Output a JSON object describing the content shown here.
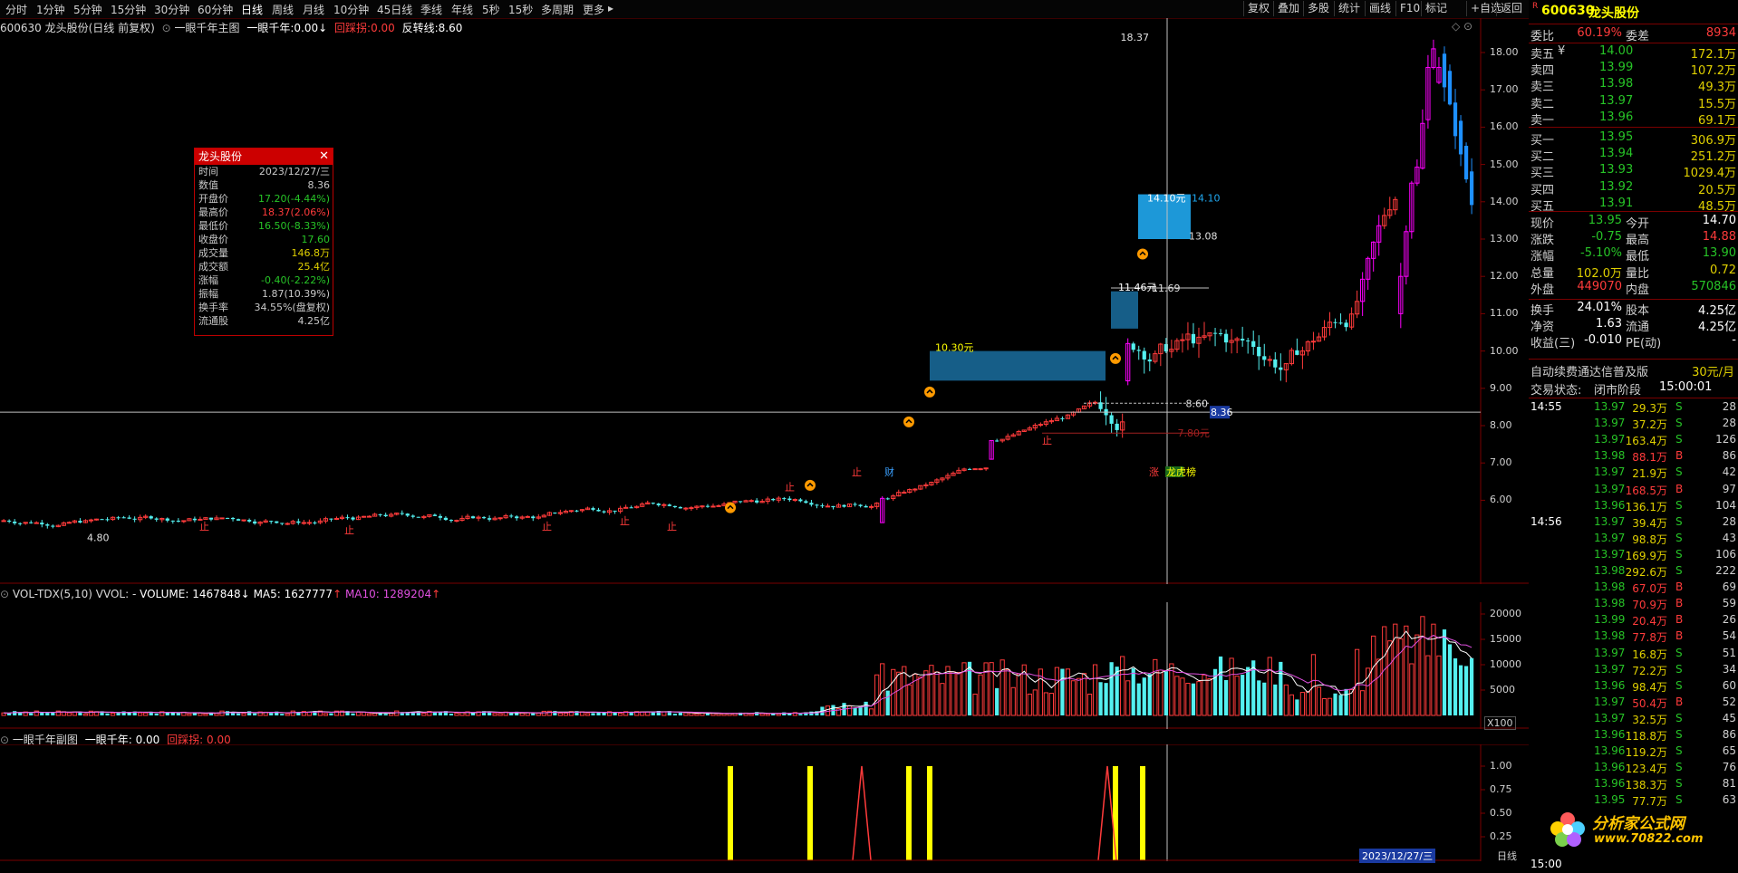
{
  "toolbar": {
    "periods": [
      "分时",
      "1分钟",
      "5分钟",
      "15分钟",
      "30分钟",
      "60分钟",
      "日线",
      "周线",
      "月线",
      "10分钟",
      "45日线",
      "季线",
      "年线",
      "5秒",
      "15秒",
      "多周期",
      "更多"
    ],
    "active_period": "日线",
    "right_buttons": [
      "复权",
      "叠加",
      "多股",
      "统计",
      "画线",
      "F10",
      "标记",
      "+自选",
      "返回"
    ]
  },
  "main_info": {
    "code_name": "600630 龙头股份(日线 前复权)",
    "indicator_name": "一眼千年主图",
    "ind1_label": "一眼千年:",
    "ind1_value": "0.00",
    "ind2_label": "回踩拐:",
    "ind2_value": "0.00",
    "ind3_label": "反转线:",
    "ind3_value": "8.60"
  },
  "price_axis": [
    "18.00",
    "17.00",
    "16.00",
    "15.00",
    "14.00",
    "13.00",
    "12.00",
    "11.00",
    "10.00",
    "9.00",
    "8.00",
    "7.00",
    "6.00"
  ],
  "chart_labels": {
    "high_label": "18.37",
    "low_label": "4.80",
    "cursor_price": "8.36",
    "reversal_label": "8.60",
    "support_label": "7.80元",
    "box1_label": "10.30元",
    "box2_label": "11.46元",
    "box2_right": "11.69",
    "box3_label": "14.10元",
    "box3_right": "14.10",
    "box3_low": "13.08",
    "up_marker": "止",
    "event_cai": "财",
    "event_zhang": "涨",
    "event_longhu": "龙虎榜"
  },
  "popup": {
    "title": "龙头股份",
    "rows": [
      {
        "k": "时间",
        "v": "2023/12/27/三",
        "c": "#c8c8c8"
      },
      {
        "k": "数值",
        "v": "8.36",
        "c": "#c8c8c8"
      },
      {
        "k": "开盘价",
        "v": "17.20(-4.44%)",
        "c": "#27c427"
      },
      {
        "k": "最高价",
        "v": "18.37(2.06%)",
        "c": "#ff3b3b"
      },
      {
        "k": "最低价",
        "v": "16.50(-8.33%)",
        "c": "#27c427"
      },
      {
        "k": "收盘价",
        "v": "17.60",
        "c": "#27c427"
      },
      {
        "k": "成交量",
        "v": "146.8万",
        "c": "#e0d000"
      },
      {
        "k": "成交额",
        "v": "25.4亿",
        "c": "#e0d000"
      },
      {
        "k": "涨幅",
        "v": "-0.40(-2.22%)",
        "c": "#27c427"
      },
      {
        "k": "振幅",
        "v": "1.87(10.39%)",
        "c": "#c8c8c8"
      },
      {
        "k": "换手率",
        "v": "34.55%(盘复权)",
        "c": "#c8c8c8"
      },
      {
        "k": "流通股",
        "v": "4.25亿",
        "c": "#c8c8c8"
      }
    ]
  },
  "vol_info": {
    "name": "VOL-TDX(5,10)",
    "vvol": "VVOL: -",
    "volume": "VOLUME: 1467848",
    "ma5": "MA5: 1627777",
    "ma10": "MA10: 1289204"
  },
  "vol_axis": [
    "20000",
    "15000",
    "10000",
    "5000"
  ],
  "vol_unit": "X100",
  "sub_info": {
    "name": "一眼千年副图",
    "ind1": "一眼千年: 0.00",
    "ind2": "回踩拐: 0.00"
  },
  "sub_axis": [
    "1.00",
    "0.75",
    "0.50",
    "0.25"
  ],
  "bottom": {
    "date_label": "2023/12/27/三",
    "period_label": "日线"
  },
  "quote": {
    "badge": "R",
    "code": "600630",
    "name": "龙头股份",
    "weibi_label": "委比",
    "weibi_value": "60.19%",
    "weicha_label": "委差",
    "weicha_value": "8934",
    "sells": [
      {
        "label": "卖五",
        "price": "14.00",
        "vol": "172.1万",
        "flag": "¥"
      },
      {
        "label": "卖四",
        "price": "13.99",
        "vol": "107.2万",
        "flag": ""
      },
      {
        "label": "卖三",
        "price": "13.98",
        "vol": "49.3万",
        "flag": ""
      },
      {
        "label": "卖二",
        "price": "13.97",
        "vol": "15.5万",
        "flag": ""
      },
      {
        "label": "卖一",
        "price": "13.96",
        "vol": "69.1万",
        "flag": ""
      }
    ],
    "buys": [
      {
        "label": "买一",
        "price": "13.95",
        "vol": "306.9万"
      },
      {
        "label": "买二",
        "price": "13.94",
        "vol": "251.2万"
      },
      {
        "label": "买三",
        "price": "13.93",
        "vol": "1029.4万"
      },
      {
        "label": "买四",
        "price": "13.92",
        "vol": "20.5万"
      },
      {
        "label": "买五",
        "price": "13.91",
        "vol": "48.5万"
      }
    ],
    "stats": [
      {
        "l1": "现价",
        "v1": "13.95",
        "c1": "#27c427",
        "l2": "今开",
        "v2": "14.70",
        "c2": "#ffffff"
      },
      {
        "l1": "涨跌",
        "v1": "-0.75",
        "c1": "#27c427",
        "l2": "最高",
        "v2": "14.88",
        "c2": "#ff3b3b"
      },
      {
        "l1": "涨幅",
        "v1": "-5.10%",
        "c1": "#27c427",
        "l2": "最低",
        "v2": "13.90",
        "c2": "#27c427"
      },
      {
        "l1": "总量",
        "v1": "102.0万",
        "c1": "#e0d000",
        "l2": "量比",
        "v2": "0.72",
        "c2": "#e0d000"
      },
      {
        "l1": "外盘",
        "v1": "449070",
        "c1": "#ff3b3b",
        "l2": "内盘",
        "v2": "570846",
        "c2": "#27c427"
      }
    ],
    "stats2": [
      {
        "l1": "换手",
        "v1": "24.01%",
        "l2": "股本",
        "v2": "4.25亿"
      },
      {
        "l1": "净资",
        "v1": "1.63",
        "l2": "流通",
        "v2": "4.25亿"
      },
      {
        "l1": "收益(三)",
        "v1": "-0.010",
        "l2": "PE(动)",
        "v2": "-"
      }
    ],
    "ad_text": "自动续费通达信普及版",
    "ad_price": "30元/月",
    "status_label": "交易状态:",
    "status_value": "闭市阶段",
    "status_time": "15:00:01"
  },
  "ticks": [
    {
      "t": "14:55",
      "p": "13.97",
      "v": "29.3万",
      "s": "S",
      "n": "28"
    },
    {
      "t": "",
      "p": "13.97",
      "v": "37.2万",
      "s": "S",
      "n": "28"
    },
    {
      "t": "",
      "p": "13.97",
      "v": "163.4万",
      "s": "S",
      "n": "126"
    },
    {
      "t": "",
      "p": "13.98",
      "v": "88.1万",
      "s": "B",
      "n": "86"
    },
    {
      "t": "",
      "p": "13.97",
      "v": "21.9万",
      "s": "S",
      "n": "42"
    },
    {
      "t": "",
      "p": "13.97",
      "v": "168.5万",
      "s": "B",
      "n": "97"
    },
    {
      "t": "",
      "p": "13.96",
      "v": "136.1万",
      "s": "S",
      "n": "104"
    },
    {
      "t": "14:56",
      "p": "13.97",
      "v": "39.4万",
      "s": "S",
      "n": "28"
    },
    {
      "t": "",
      "p": "13.97",
      "v": "98.8万",
      "s": "S",
      "n": "43"
    },
    {
      "t": "",
      "p": "13.97",
      "v": "169.9万",
      "s": "S",
      "n": "106"
    },
    {
      "t": "",
      "p": "13.98",
      "v": "292.6万",
      "s": "S",
      "n": "222"
    },
    {
      "t": "",
      "p": "13.98",
      "v": "67.0万",
      "s": "B",
      "n": "69"
    },
    {
      "t": "",
      "p": "13.98",
      "v": "70.9万",
      "s": "B",
      "n": "59"
    },
    {
      "t": "",
      "p": "13.99",
      "v": "20.4万",
      "s": "B",
      "n": "26"
    },
    {
      "t": "",
      "p": "13.98",
      "v": "77.8万",
      "s": "B",
      "n": "54"
    },
    {
      "t": "",
      "p": "13.97",
      "v": "16.8万",
      "s": "S",
      "n": "51"
    },
    {
      "t": "",
      "p": "13.97",
      "v": "72.2万",
      "s": "S",
      "n": "34"
    },
    {
      "t": "",
      "p": "13.96",
      "v": "98.4万",
      "s": "S",
      "n": "60"
    },
    {
      "t": "",
      "p": "13.97",
      "v": "50.4万",
      "s": "B",
      "n": "52"
    },
    {
      "t": "",
      "p": "13.97",
      "v": "32.5万",
      "s": "S",
      "n": "45"
    },
    {
      "t": "",
      "p": "13.96",
      "v": "118.8万",
      "s": "S",
      "n": "86"
    },
    {
      "t": "",
      "p": "13.96",
      "v": "119.2万",
      "s": "S",
      "n": "65"
    },
    {
      "t": "",
      "p": "13.96",
      "v": "123.4万",
      "s": "S",
      "n": "76"
    },
    {
      "t": "",
      "p": "13.96",
      "v": "138.3万",
      "s": "S",
      "n": "81"
    },
    {
      "t": "",
      "p": "13.95",
      "v": "77.7万",
      "s": "S",
      "n": "63"
    }
  ],
  "tick_last_time": "15:00",
  "logo": {
    "line1": "分析家公式网",
    "line2": "www.70822.com"
  },
  "colors": {
    "up": "#ff3b3b",
    "down": "#27c427",
    "magenta": "#ff00ff",
    "cyan": "#54f0f0",
    "blue": "#1e90d0",
    "yellow": "#ffff00",
    "grid": "#7a0000"
  }
}
